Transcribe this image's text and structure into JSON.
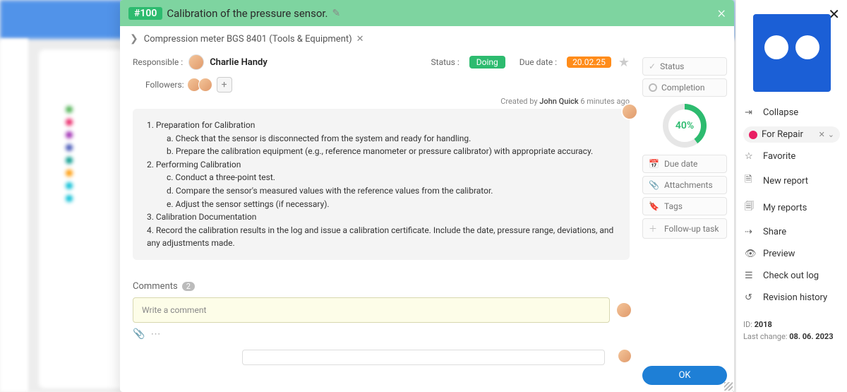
{
  "header": {
    "task_id": "#100",
    "title": "Calibration of the pressure sensor."
  },
  "breadcrumb": {
    "label": "Compression meter BGS 8401 (Tools & Equipment)"
  },
  "meta": {
    "responsible_label": "Responsible :",
    "responsible_name": "Charlie Handy",
    "status_label": "Status :",
    "status_value": "Doing",
    "due_label": "Due date :",
    "due_value": "20.02.25",
    "followers_label": "Followers:",
    "created_prefix": "Created by",
    "created_by": "John Quick",
    "created_ago": "6 minutes ago"
  },
  "description": {
    "items": [
      "1. Preparation for Calibration",
      "a. Check that the sensor is disconnected from the system and ready for handling.",
      "b. Prepare the calibration equipment (e.g., reference manometer or pressure calibrator) with appropriate accuracy.",
      "2. Performing Calibration",
      "c. Conduct a three-point test.",
      "d. Compare the sensor's measured values with the reference values from the calibrator.",
      "e. Adjust the sensor settings (if necessary).",
      "3. Calibration Documentation",
      "4. Record the calibration results in the log and issue a calibration certificate. Include the date, pressure range, deviations, and any adjustments made."
    ]
  },
  "comments": {
    "label": "Comments",
    "count": "2",
    "placeholder": "Write a comment"
  },
  "side": {
    "status": "Status",
    "completion": "Completion",
    "percent": "40%",
    "due_date": "Due date",
    "attachments": "Attachments",
    "tags": "Tags",
    "followup": "Follow-up task",
    "ok": "OK"
  },
  "inspector": {
    "collapse": "Collapse",
    "tag": "For Repair",
    "favorite": "Favorite",
    "new_report": "New report",
    "my_reports": "My reports",
    "share": "Share",
    "preview": "Preview",
    "checkout": "Check out log",
    "revision": "Revision history",
    "id_label": "ID:",
    "id_value": "2018",
    "lastchange_label": "Last change:",
    "lastchange_value": "08. 06. 2023"
  }
}
